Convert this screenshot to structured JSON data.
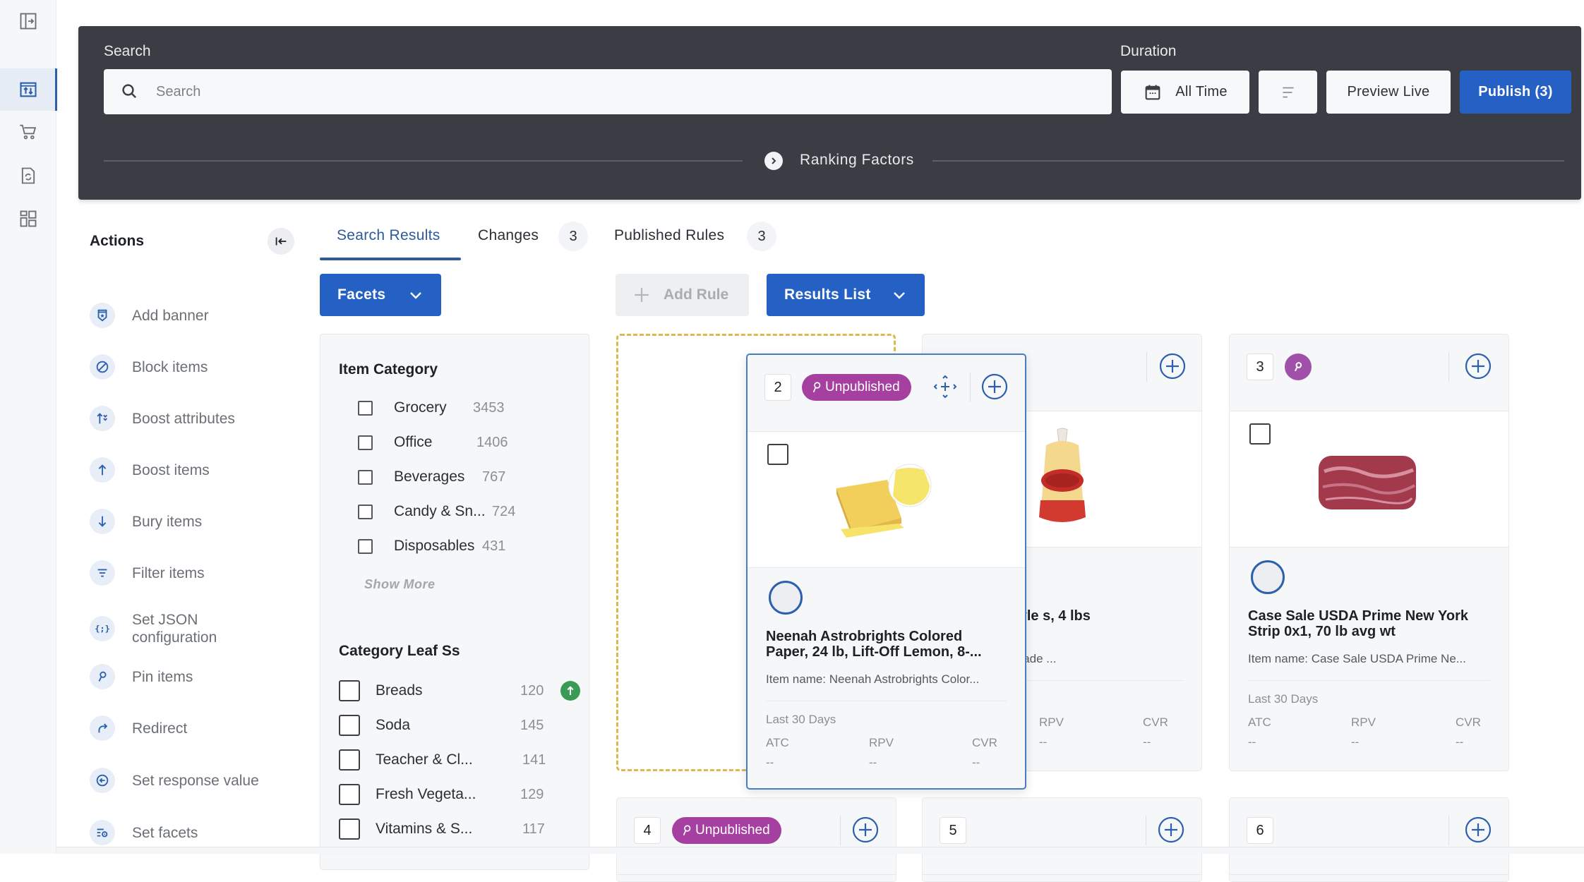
{
  "rail": {
    "items": [
      {
        "name": "expand-panel",
        "icon": "sidebar-expand-icon",
        "active": false
      },
      {
        "name": "search-ranking",
        "icon": "ranking-icon",
        "active": true
      },
      {
        "name": "commerce",
        "icon": "cart-icon",
        "active": false
      },
      {
        "name": "sync-document",
        "icon": "document-sync-icon",
        "active": false
      },
      {
        "name": "dashboard",
        "icon": "grid-icon",
        "active": false
      }
    ]
  },
  "header": {
    "search_label": "Search",
    "search_placeholder": "Search",
    "search_value": "",
    "duration_label": "Duration",
    "duration_value": "All Time",
    "filter_icon": "filter-lines-icon",
    "preview_label": "Preview Live",
    "publish_label": "Publish (3)",
    "ranking_factors_label": "Ranking Factors"
  },
  "actions": {
    "title": "Actions",
    "items": [
      {
        "label": "Add banner",
        "icon": "banner-icon"
      },
      {
        "label": "Block items",
        "icon": "block-icon"
      },
      {
        "label": "Boost attributes",
        "icon": "boost-attributes-icon"
      },
      {
        "label": "Boost items",
        "icon": "arrow-up-icon"
      },
      {
        "label": "Bury items",
        "icon": "arrow-down-icon"
      },
      {
        "label": "Filter items",
        "icon": "filter-icon"
      },
      {
        "label": "Set JSON configuration",
        "icon": "json-icon"
      },
      {
        "label": "Pin items",
        "icon": "pin-icon"
      },
      {
        "label": "Redirect",
        "icon": "redirect-icon"
      },
      {
        "label": "Set response value",
        "icon": "response-icon"
      },
      {
        "label": "Set facets",
        "icon": "facets-settings-icon"
      }
    ]
  },
  "tabs": [
    {
      "label": "Search Results",
      "active": true
    },
    {
      "label": "Changes",
      "badge": "3"
    },
    {
      "label": "Published Rules",
      "badge": "3"
    }
  ],
  "toolbar": {
    "facets_label": "Facets",
    "add_rule_label": "Add Rule",
    "results_view_label": "Results List"
  },
  "facets": {
    "item_category": {
      "title": "Item Category",
      "options": [
        {
          "name": "Grocery",
          "count": "3453",
          "checked": false
        },
        {
          "name": "Office",
          "count": "1406",
          "checked": false
        },
        {
          "name": "Beverages",
          "count": "767",
          "checked": false
        },
        {
          "name": "Candy & Sn...",
          "count": "724",
          "checked": false
        },
        {
          "name": "Disposables",
          "count": "431",
          "checked": false
        }
      ],
      "show_more": "Show More"
    },
    "category_leaf": {
      "title": "Category Leaf Ss",
      "options": [
        {
          "name": "Breads",
          "count": "120",
          "checked": false,
          "boosted": true
        },
        {
          "name": "Soda",
          "count": "145",
          "checked": false
        },
        {
          "name": "Teacher & Cl...",
          "count": "141",
          "checked": false
        },
        {
          "name": "Fresh Vegeta...",
          "count": "129",
          "checked": false
        },
        {
          "name": "Vitamins & S...",
          "count": "117",
          "checked": false
        }
      ]
    }
  },
  "results": {
    "metrics_period": "Last 30 Days",
    "metric_labels": [
      "ATC",
      "RPV",
      "CVR"
    ],
    "cards": [
      {
        "position": "2",
        "status": "Unpublished",
        "pinned": true,
        "dragging": true,
        "title": "Neenah Astrobrights Colored Paper, 24 lb, Lift-Off Lemon, 8-...",
        "item_name": "Item name: Neenah Astrobrights Color...",
        "metrics": [
          "--",
          "--",
          "--"
        ]
      },
      {
        "position": "",
        "status": "",
        "pinned": false,
        "title": "ta Homemade Style s, 4 lbs",
        "item_name": "untry Pasta Homemade ...",
        "metrics": [
          "--",
          "--",
          "--"
        ]
      },
      {
        "position": "3",
        "status": "",
        "pinned": true,
        "title": "Case Sale USDA Prime New York Strip 0x1, 70 lb avg wt",
        "item_name": "Item name: Case Sale USDA Prime Ne...",
        "metrics": [
          "--",
          "--",
          "--"
        ]
      },
      {
        "position": "4",
        "status": "Unpublished",
        "pinned": true
      },
      {
        "position": "5",
        "status": "",
        "pinned": false
      },
      {
        "position": "6",
        "status": "",
        "pinned": false
      }
    ]
  },
  "colors": {
    "primary": "#2561c4",
    "header_bg": "#3a3d44",
    "pin_badge": "#a640a0",
    "boost_green": "#3c9a57",
    "drop_outline": "#e0b64e"
  }
}
